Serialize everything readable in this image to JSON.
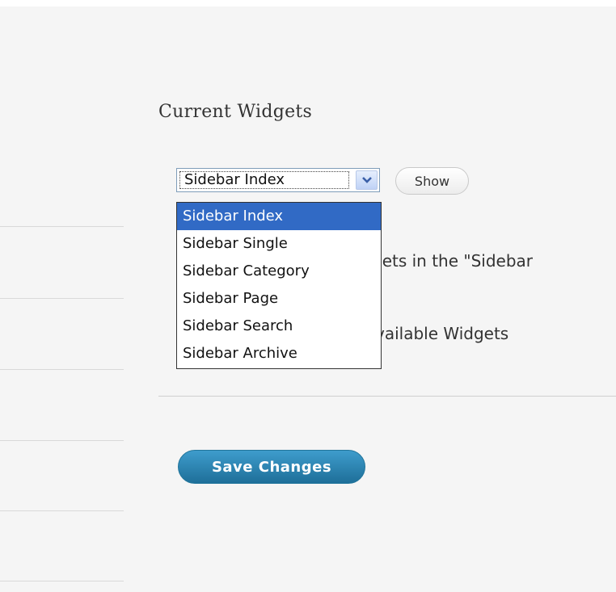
{
  "widgets": {
    "heading": "Current Widgets",
    "sidebar_select": {
      "selected": "Sidebar Index",
      "options": [
        "Sidebar Index",
        "Sidebar Single",
        "Sidebar Category",
        "Sidebar Page",
        "Sidebar Search",
        "Sidebar Archive"
      ]
    },
    "show_button": "Show",
    "partial_text_1": "gets in the \"Sidebar",
    "partial_text_2": "vailable Widgets",
    "save_button": "Save Changes"
  },
  "colors": {
    "option_highlight": "#316ac5",
    "save_button": "#21759b",
    "page_background": "#f5f5f5"
  },
  "icons": {
    "select_arrow": "chevron-down-icon"
  }
}
